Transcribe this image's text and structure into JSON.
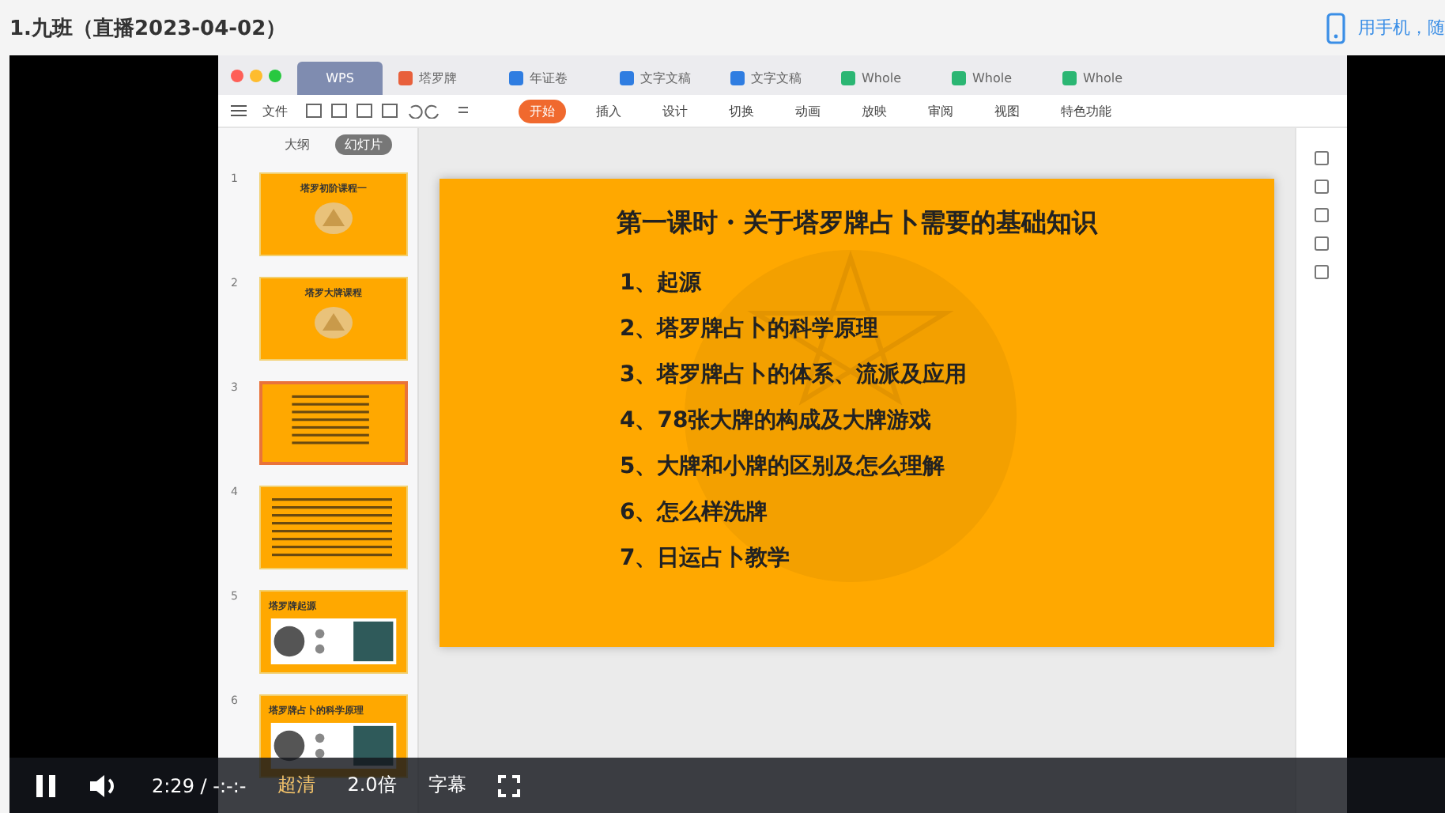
{
  "page": {
    "title": "1.九班（直播2023-04-02）",
    "mobile_link": "用手机，随"
  },
  "wps": {
    "tabs": [
      {
        "label": "WPS",
        "selected": true,
        "color": "#7f8cb0"
      },
      {
        "label": "塔罗牌",
        "selected": false,
        "color": "#e8603c"
      },
      {
        "label": "年证卷",
        "selected": false,
        "color": "#2f7de1"
      },
      {
        "label": "文字文稿",
        "selected": false,
        "color": "#2f7de1"
      },
      {
        "label": "文字文稿",
        "selected": false,
        "color": "#2f7de1"
      },
      {
        "label": "Whole",
        "selected": false,
        "color": "#2bb673"
      },
      {
        "label": "Whole",
        "selected": false,
        "color": "#2bb673"
      },
      {
        "label": "Whole",
        "selected": false,
        "color": "#2bb673"
      }
    ],
    "file_menu": "文件",
    "ribbon": [
      {
        "label": "开始",
        "selected": true
      },
      {
        "label": "插入",
        "selected": false
      },
      {
        "label": "设计",
        "selected": false
      },
      {
        "label": "切换",
        "selected": false
      },
      {
        "label": "动画",
        "selected": false
      },
      {
        "label": "放映",
        "selected": false
      },
      {
        "label": "审阅",
        "selected": false
      },
      {
        "label": "视图",
        "selected": false
      },
      {
        "label": "特色功能",
        "selected": false
      }
    ],
    "panel_tabs": [
      {
        "label": "大纲",
        "selected": false
      },
      {
        "label": "幻灯片",
        "selected": true
      }
    ],
    "thumbnails": [
      {
        "number": "1",
        "kind": "cover",
        "title": "塔罗初阶课程一",
        "selected": false
      },
      {
        "number": "2",
        "kind": "cover",
        "title": "塔罗大牌课程",
        "selected": false
      },
      {
        "number": "3",
        "kind": "list",
        "selected": true
      },
      {
        "number": "4",
        "kind": "text",
        "selected": false
      },
      {
        "number": "5",
        "title": "塔罗牌起源",
        "selected": false
      },
      {
        "number": "6",
        "title": "塔罗牌占卜的科学原理",
        "selected": false
      }
    ],
    "slide": {
      "title": "第一课时・关于塔罗牌占卜需要的基础知识",
      "items": [
        "1、起源",
        "2、塔罗牌占卜的科学原理",
        "3、塔罗牌占卜的体系、流派及应用",
        "4、78张大牌的构成及大牌游戏",
        "5、大牌和小牌的区别及怎么理解",
        "6、怎么样洗牌",
        "7、日运占卜教学"
      ]
    }
  },
  "player": {
    "playing": true,
    "time": "2:29",
    "separator": "/",
    "duration": "-:-:-",
    "quality": "超清",
    "speed": "2.0倍",
    "subtitles": "字幕"
  }
}
